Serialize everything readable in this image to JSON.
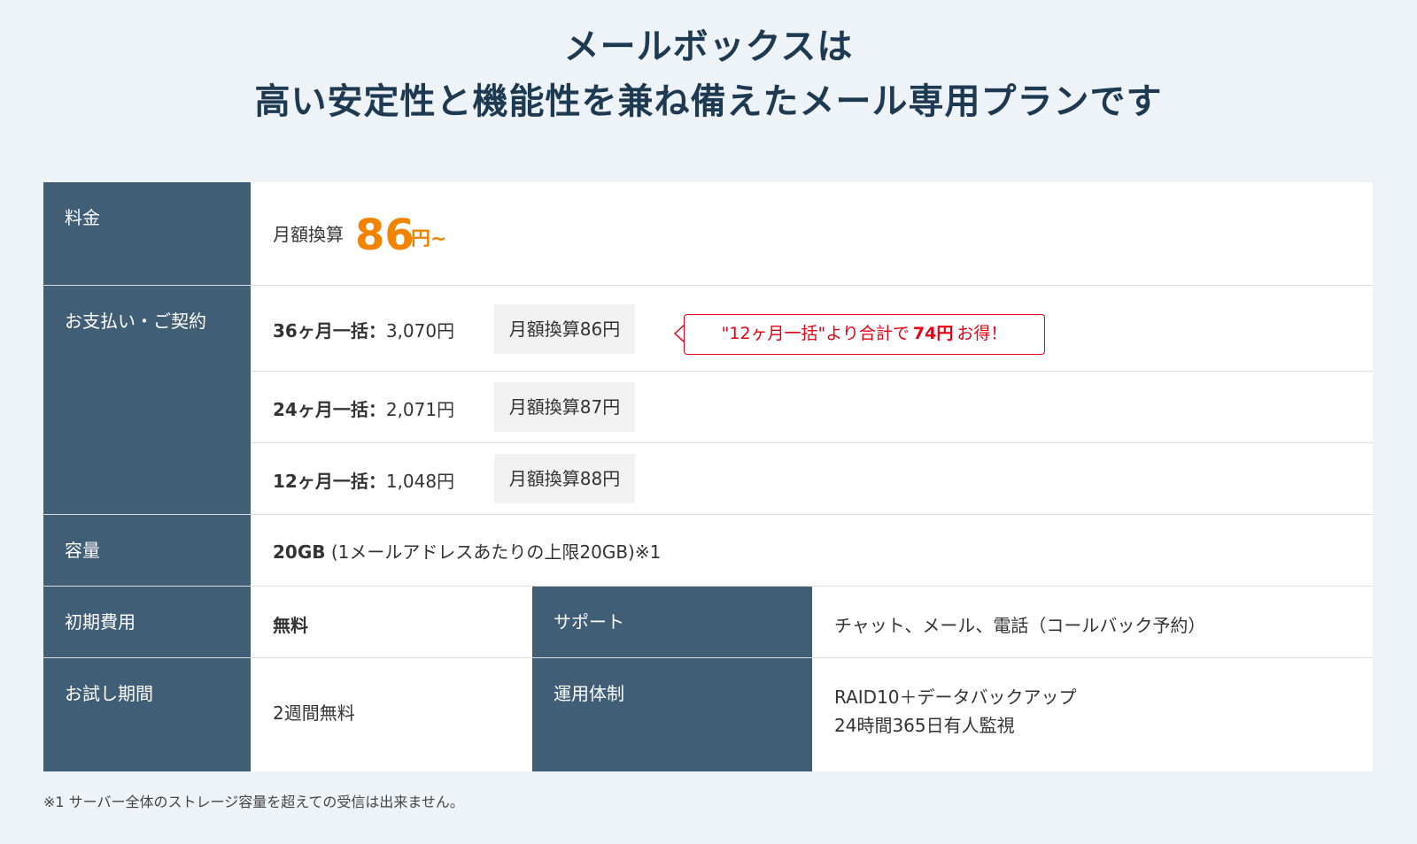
{
  "heading": {
    "line1": "メールボックスは",
    "line2": "高い安定性と機能性を兼ね備えたメール専用プランです"
  },
  "rows": {
    "price": {
      "header": "料金",
      "prefix": "月額換算",
      "amount": "86",
      "unit": "円~"
    },
    "payment": {
      "header": "お支払い・ご契約",
      "plans": [
        {
          "term": "36ヶ月一括",
          "sep": "：",
          "total": "3,070円",
          "monthly": "月額換算86円"
        },
        {
          "term": "24ヶ月一括",
          "sep": "：",
          "total": "2,071円",
          "monthly": "月額換算87円"
        },
        {
          "term": "12ヶ月一括",
          "sep": "：",
          "total": "1,048円",
          "monthly": "月額換算88円"
        }
      ],
      "callout": {
        "pre": "\"12ヶ月一括\"より合計で",
        "amount": "74円",
        "post": "お得！"
      }
    },
    "capacity": {
      "header": "容量",
      "value_bold": "20GB",
      "value_rest": " (1メールアドレスあたりの上限20GB)※1"
    },
    "initial": {
      "header": "初期費用",
      "value": "無料",
      "side_header": "サポート",
      "side_value": "チャット、メール、電話（コールバック予約）"
    },
    "trial": {
      "header": "お試し期間",
      "value": "2週間無料",
      "side_header": "運用体制",
      "side_line1": "RAID10＋データバックアップ",
      "side_line2": "24時間365日有人監視"
    }
  },
  "footnote": "※1  サーバー全体のストレージ容量を超えての受信は出来ません。",
  "colors": {
    "background": "#eef3f7",
    "header_cell": "#415e77",
    "title": "#1e3a52",
    "price_accent": "#f08300",
    "callout_red": "#e60012"
  }
}
